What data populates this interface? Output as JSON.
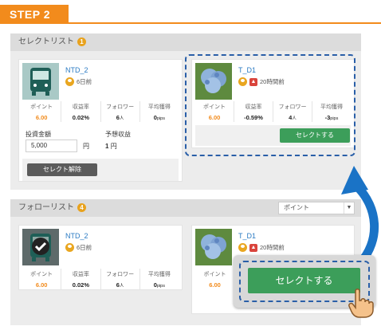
{
  "step": {
    "label": "STEP 2"
  },
  "select_list": {
    "title": "セレクトリスト",
    "count": "1",
    "card1": {
      "name": "NTD_2",
      "time": "6日前",
      "stats": [
        {
          "label": "ポイント",
          "value": "6.00"
        },
        {
          "label": "収益率",
          "value": "0.02%"
        },
        {
          "label": "フォロワー",
          "value": "6",
          "unit": "人"
        },
        {
          "label": "平均獲得",
          "value": "0",
          "unit": "pips"
        }
      ],
      "invest_label": "投資金額",
      "invest_value": "5,000",
      "invest_unit": "円",
      "profit_label": "予想収益",
      "profit_value": "1",
      "profit_unit": "円",
      "release_button": "セレクト解除"
    },
    "card2": {
      "name": "T_D1",
      "time": "20時間前",
      "stats": [
        {
          "label": "ポイント",
          "value": "6.00"
        },
        {
          "label": "収益率",
          "value": "-0.59%"
        },
        {
          "label": "フォロワー",
          "value": "4",
          "unit": "人"
        },
        {
          "label": "平均獲得",
          "value": "-3",
          "unit": "pips"
        }
      ],
      "select_button": "セレクトする"
    }
  },
  "follow_list": {
    "title": "フォローリスト",
    "count": "4",
    "sort_selected": "ポイント",
    "card1": {
      "name": "NTD_2",
      "time": "6日前",
      "stats": [
        {
          "label": "ポイント",
          "value": "6.00"
        },
        {
          "label": "収益率",
          "value": "0.02%"
        },
        {
          "label": "フォロワー",
          "value": "6",
          "unit": "人"
        },
        {
          "label": "平均獲得",
          "value": "0",
          "unit": "pips"
        }
      ]
    },
    "card2": {
      "name": "T_D1",
      "time": "20時間前",
      "stats": [
        {
          "label": "ポイント",
          "value": "6.00"
        }
      ],
      "select_button": "セレクトする"
    }
  },
  "colors": {
    "accent": "#f28b1c",
    "green": "#3c9e5a",
    "link": "#2b7bc3",
    "dash": "#2a5fa8",
    "arrow": "#1a73c6"
  },
  "icons": [
    "bus-icon",
    "hydrangea-icon",
    "user-icon",
    "thumbs-up-icon",
    "check-icon",
    "curved-arrow-icon",
    "hand-pointer-icon"
  ]
}
